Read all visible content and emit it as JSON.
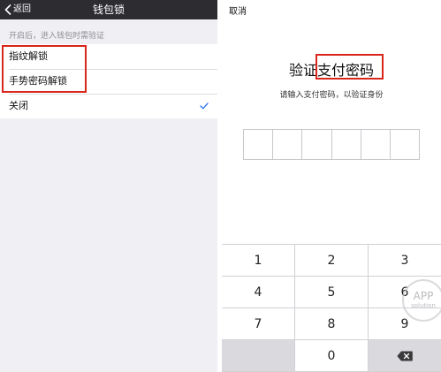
{
  "left_screen": {
    "nav": {
      "back_label": "返回",
      "title": "钱包锁"
    },
    "hint": "开启后，进入钱包时需验证",
    "options": [
      {
        "label": "指纹解锁",
        "selected": false
      },
      {
        "label": "手势密码解锁",
        "selected": false
      },
      {
        "label": "关闭",
        "selected": true
      }
    ]
  },
  "right_screen": {
    "cancel_label": "取消",
    "title": "验证支付密码",
    "subtitle": "请输入支付密码，以验证身份",
    "pin_length": 6,
    "keypad": {
      "row1": [
        "1",
        "2",
        "3"
      ],
      "row2": [
        "4",
        "5",
        "6"
      ],
      "row3": [
        "7",
        "8",
        "9"
      ],
      "row4": [
        "",
        "0",
        ""
      ]
    },
    "watermark": {
      "line1": "APP",
      "line2": "solution"
    }
  },
  "colors": {
    "nav_bar": "#2c2c31",
    "check_blue": "#3478f6",
    "highlight_red": "#d9261c",
    "page_gray": "#efeff4"
  }
}
